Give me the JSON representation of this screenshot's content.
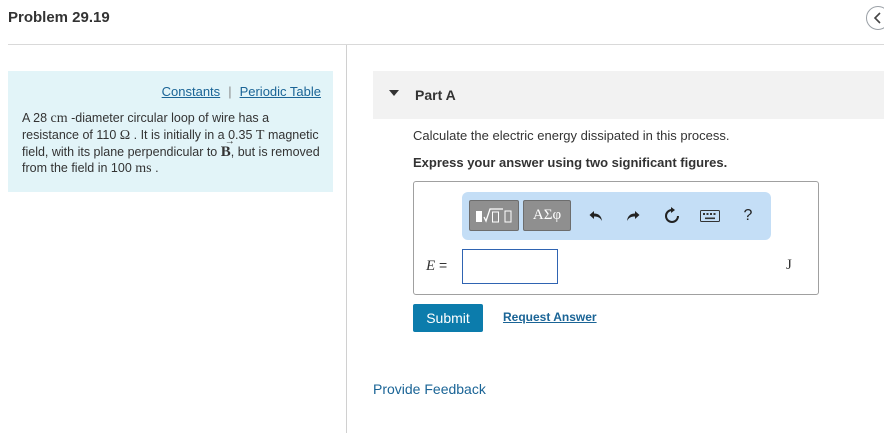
{
  "header": {
    "title": "Problem 29.19",
    "collapse_icon": "chevron-left-icon"
  },
  "info_panel": {
    "links": [
      "Constants",
      "Periodic Table"
    ],
    "separator": "|",
    "problem": {
      "t1": "A 28 ",
      "u1": "cm",
      "t2": " -diameter circular loop of wire has a resistance of 110 ",
      "u2": "Ω",
      "t3": " . It is initially in a 0.35 ",
      "u3": "T",
      "t4": " magnetic field, with its plane perpendicular to ",
      "vec": "B",
      "t5": ", but is removed from the field in 100 ",
      "u4": "ms",
      "t6": " ."
    }
  },
  "part": {
    "title": "Part A",
    "question": "Calculate the electric energy dissipated in this process.",
    "instruction": "Express your answer using two significant figures."
  },
  "answer": {
    "toolbar": {
      "templates_icon": "templates-icon",
      "greek_label": "ΑΣφ",
      "undo_icon": "undo-icon",
      "redo_icon": "redo-icon",
      "reset_icon": "reset-icon",
      "keyboard_icon": "keyboard-icon",
      "help_label": "?"
    },
    "variable": "E",
    "equals": " =",
    "value": "",
    "unit": "J"
  },
  "actions": {
    "submit": "Submit",
    "request": "Request Answer"
  },
  "footer": {
    "feedback": "Provide Feedback"
  },
  "colors": {
    "info_bg": "#e2f4f8",
    "link": "#1a6496",
    "submit_bg": "#0c7cac",
    "toolbar_bg": "#c4def6",
    "input_border": "#2f64b2"
  }
}
